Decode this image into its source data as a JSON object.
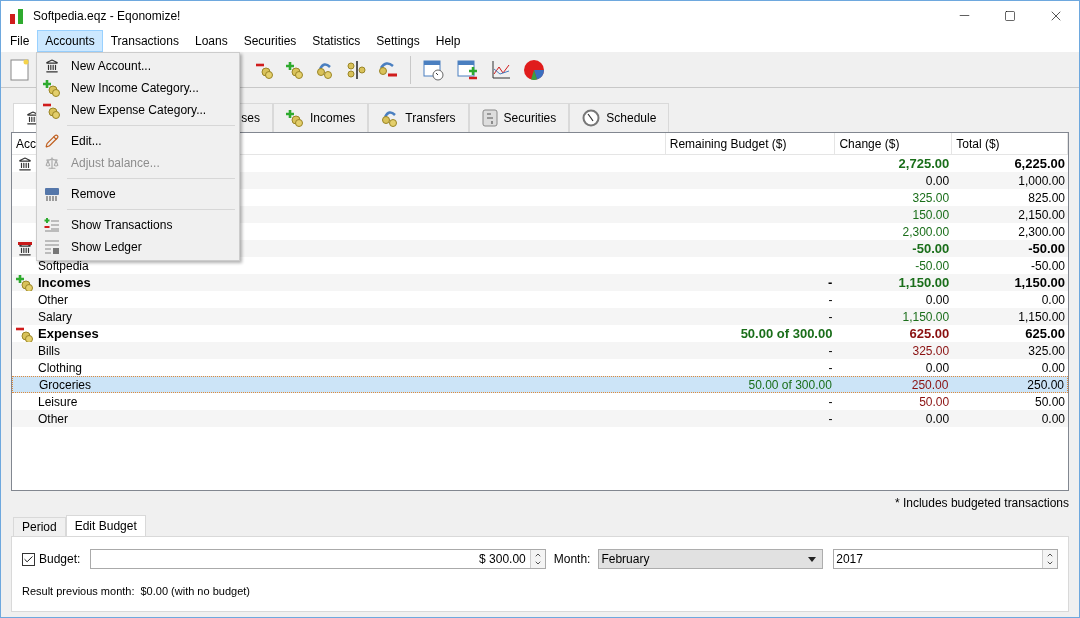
{
  "window": {
    "title": "Softpedia.eqz - Eqonomize!"
  },
  "menu_bar": [
    {
      "label": "File",
      "selected": false
    },
    {
      "label": "Accounts",
      "selected": true
    },
    {
      "label": "Transactions",
      "selected": false
    },
    {
      "label": "Loans",
      "selected": false
    },
    {
      "label": "Securities",
      "selected": false
    },
    {
      "label": "Statistics",
      "selected": false
    },
    {
      "label": "Settings",
      "selected": false
    },
    {
      "label": "Help",
      "selected": false
    }
  ],
  "accounts_menu": [
    {
      "kind": "item",
      "label": "New Account...",
      "disabled": false
    },
    {
      "kind": "item",
      "label": "New Income Category...",
      "disabled": false
    },
    {
      "kind": "item",
      "label": "New Expense Category...",
      "disabled": false
    },
    {
      "kind": "separator"
    },
    {
      "kind": "item",
      "label": "Edit...",
      "disabled": false
    },
    {
      "kind": "item",
      "label": "Adjust balance...",
      "disabled": true
    },
    {
      "kind": "separator"
    },
    {
      "kind": "item",
      "label": "Remove",
      "disabled": false
    },
    {
      "kind": "separator"
    },
    {
      "kind": "item",
      "label": "Show Transactions",
      "disabled": false
    },
    {
      "kind": "item",
      "label": "Show Ledger",
      "disabled": false
    }
  ],
  "tabs": [
    {
      "kind": "accounts",
      "selected": true
    },
    {
      "kind": "expenses",
      "label": "ses",
      "selected": false
    },
    {
      "kind": "incomes",
      "label": "Incomes",
      "selected": false
    },
    {
      "kind": "transfers",
      "label": "Transfers",
      "selected": false
    },
    {
      "kind": "securities",
      "label": "Securities",
      "selected": false
    },
    {
      "kind": "schedule",
      "label": "Schedule",
      "selected": false
    }
  ],
  "table": {
    "columns": [
      "Acc",
      "Remaining Budget ($)",
      "Change ($)",
      "Total ($)"
    ],
    "rows": [
      {
        "kind": "assets",
        "change": "2,725.00",
        "color": "#1a6e1a",
        "total": "6,225.00",
        "selected": false
      },
      {
        "kind": "item",
        "change": "0.00",
        "total": "1,000.00",
        "selected": false
      },
      {
        "kind": "item",
        "change": "325.00",
        "color": "#1a6e1a",
        "total": "825.00",
        "selected": false
      },
      {
        "kind": "item",
        "change": "150.00",
        "color": "#1a6e1a",
        "total": "2,150.00",
        "selected": false
      },
      {
        "kind": "item",
        "change": "2,300.00",
        "color": "#1a6e1a",
        "total": "2,300.00",
        "selected": false
      },
      {
        "kind": "liabilities",
        "change": "-50.00",
        "color": "#1a6e1a",
        "total": "-50.00",
        "selected": false
      },
      {
        "kind": "item",
        "name": "Softpedia",
        "change": "-50.00",
        "color": "#1a6e1a",
        "total": "-50.00",
        "selected": false
      },
      {
        "kind": "incomes",
        "name": "Incomes",
        "budget": "-",
        "budget_set": false,
        "change": "1,150.00",
        "color": "#1a6e1a",
        "total": "1,150.00",
        "selected": false
      },
      {
        "kind": "item",
        "name": "Other",
        "budget": "-",
        "budget_set": false,
        "change": "0.00",
        "total": "0.00",
        "selected": false
      },
      {
        "kind": "item",
        "name": "Salary",
        "budget": "-",
        "budget_set": false,
        "change": "1,150.00",
        "color": "#1a6e1a",
        "total": "1,150.00",
        "selected": false
      },
      {
        "kind": "expenses",
        "name": "Expenses",
        "budget": "50.00 of 300.00",
        "budget_set": true,
        "change": "625.00",
        "color": "#8a1010",
        "total": "625.00",
        "selected": false
      },
      {
        "kind": "item",
        "name": "Bills",
        "budget": "-",
        "budget_set": false,
        "change": "325.00",
        "color": "#8a1010",
        "total": "325.00",
        "selected": false
      },
      {
        "kind": "item",
        "name": "Clothing",
        "budget": "-",
        "budget_set": false,
        "change": "0.00",
        "total": "0.00",
        "selected": false
      },
      {
        "kind": "item",
        "name": "Groceries",
        "budget": "50.00 of 300.00",
        "budget_set": true,
        "change": "250.00",
        "color": "#8a1010",
        "total": "250.00",
        "selected": true
      },
      {
        "kind": "item",
        "name": "Leisure",
        "budget": "-",
        "budget_set": false,
        "change": "50.00",
        "color": "#8a1010",
        "total": "50.00",
        "selected": false
      },
      {
        "kind": "item",
        "name": "Other",
        "budget": "-",
        "budget_set": false,
        "change": "0.00",
        "total": "0.00",
        "selected": false
      }
    ]
  },
  "footnote": "* Includes budgeted transactions",
  "bottom_tabs": [
    {
      "label": "Period",
      "selected": false
    },
    {
      "label": "Edit Budget",
      "selected": true
    }
  ],
  "budget": {
    "checked": true,
    "label": "Budget:",
    "value": "$ 300.00",
    "month_label": "Month:",
    "month": "February",
    "year": "2017"
  },
  "result": {
    "label": "Result previous month:",
    "value": "$0.00 (with no budget)"
  }
}
